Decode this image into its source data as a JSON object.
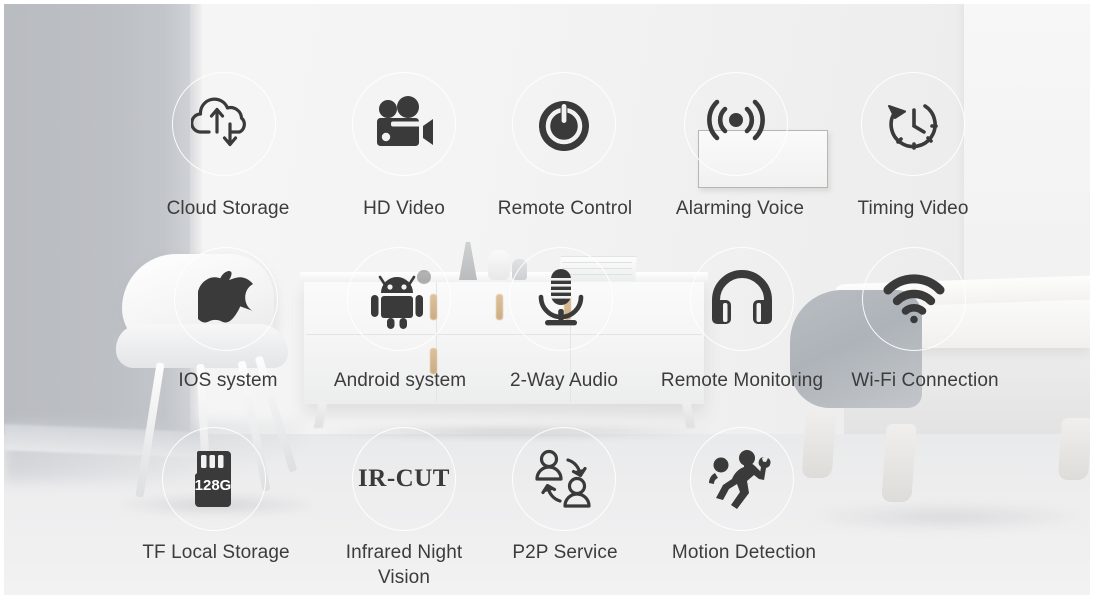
{
  "page": {
    "kind": "product-feature-infographic",
    "background_scene": "bedroom-interior",
    "text_color": "#3c3c3c",
    "ring_color": "#ffffff",
    "icon_color": "#3a3a3a"
  },
  "features": [
    {
      "id": "cloud-storage",
      "label": "Cloud Storage",
      "icon": "cloud-upload-download-icon"
    },
    {
      "id": "hd-video",
      "label": "HD Video",
      "icon": "movie-camera-icon"
    },
    {
      "id": "remote-control",
      "label": "Remote Control",
      "icon": "power-button-icon"
    },
    {
      "id": "alarming-voice",
      "label": "Alarming Voice",
      "icon": "siren-broadcast-icon"
    },
    {
      "id": "timing-video",
      "label": "Timing Video",
      "icon": "clock-rotate-icon"
    },
    {
      "id": "ios-system",
      "label": "IOS system",
      "icon": "apple-logo-icon"
    },
    {
      "id": "android-system",
      "label": "Android system",
      "icon": "android-robot-icon"
    },
    {
      "id": "two-way-audio",
      "label": "2-Way Audio",
      "icon": "microphone-icon"
    },
    {
      "id": "remote-monitoring",
      "label": "Remote Monitoring",
      "icon": "headphones-icon"
    },
    {
      "id": "wifi-connection",
      "label": "Wi-Fi Connection",
      "icon": "wifi-icon"
    },
    {
      "id": "tf-local-storage",
      "label": "TF Local Storage",
      "icon": "memory-card-icon",
      "badge": "128G"
    },
    {
      "id": "infrared-night-vision",
      "label": "Infrared Night Vision",
      "icon": "ir-cut-text-icon",
      "badge": "IR-CUT"
    },
    {
      "id": "p2p-service",
      "label": "P2P Service",
      "icon": "peer-to-peer-icon"
    },
    {
      "id": "motion-detection",
      "label": "Motion Detection",
      "icon": "running-intruder-icon"
    }
  ]
}
